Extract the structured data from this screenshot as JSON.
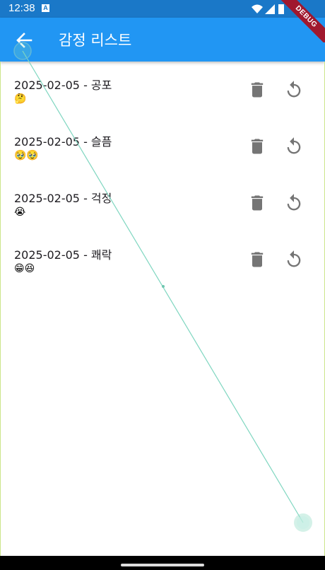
{
  "status_bar": {
    "time": "12:38",
    "notif_icon_letter": "A"
  },
  "app_bar": {
    "title": "감정 리스트",
    "debug_label": "DEBUG"
  },
  "entries": [
    {
      "title": "2025-02-05 - 공포",
      "emojis": "🤔"
    },
    {
      "title": "2025-02-05 - 슬픔",
      "emojis": "🥹🥹"
    },
    {
      "title": "2025-02-05 - 걱정",
      "emojis": "😭"
    },
    {
      "title": "2025-02-05 - 쾌락",
      "emojis": "😁😆"
    }
  ],
  "colors": {
    "app_bar": "#2196f3",
    "status_bar": "#1a78c8",
    "icon_grey": "#757575",
    "gesture_line": "#7fd6c0"
  }
}
